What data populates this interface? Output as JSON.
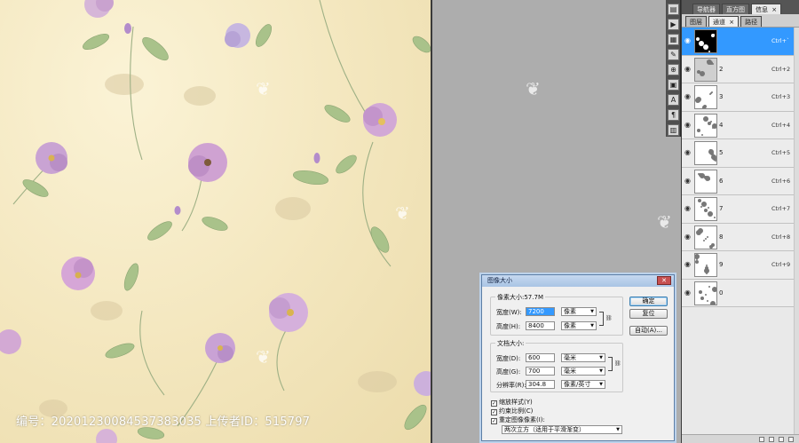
{
  "canvas": {
    "caption": "编号：20201230084537383035 上传者ID：515797"
  },
  "icons": {
    "watermark": "flame-logo-icon",
    "visibility": "eye-icon",
    "close": "close-icon",
    "link": "chain-link-icon",
    "dropdown": "chevron-down-icon"
  },
  "channels_panel": {
    "tabs_top": [
      "导航器",
      "直方图",
      "信息"
    ],
    "tabs_sub": [
      "图层",
      "通道",
      "路径"
    ],
    "channels": [
      {
        "name": "",
        "shortcut": "Ctrl+`",
        "selected": true
      },
      {
        "name": "2",
        "shortcut": "Ctrl+2"
      },
      {
        "name": "3",
        "shortcut": "Ctrl+3"
      },
      {
        "name": "4",
        "shortcut": "Ctrl+4"
      },
      {
        "name": "5",
        "shortcut": "Ctrl+5"
      },
      {
        "name": "6",
        "shortcut": "Ctrl+6"
      },
      {
        "name": "7",
        "shortcut": "Ctrl+7"
      },
      {
        "name": "8",
        "shortcut": "Ctrl+8"
      },
      {
        "name": "9",
        "shortcut": "Ctrl+9"
      },
      {
        "name": "0",
        "shortcut": ""
      }
    ]
  },
  "image_size_dialog": {
    "title": "图像大小",
    "pixel_dimensions_label": "像素大小:57.7M",
    "width_label": "宽度(W):",
    "width_value": "7200",
    "width_unit": "像素",
    "height_label": "高度(H):",
    "height_value": "8400",
    "height_unit": "像素",
    "document_size_label": "文档大小:",
    "doc_width_label": "宽度(D):",
    "doc_width_value": "600",
    "doc_width_unit": "毫米",
    "doc_height_label": "高度(G):",
    "doc_height_value": "700",
    "doc_height_unit": "毫米",
    "resolution_label": "分辨率(R):",
    "resolution_value": "304.8",
    "resolution_unit": "像素/英寸",
    "scale_styles": "缩放样式(Y)",
    "constrain_proportions": "约束比例(C)",
    "resample": "重定图像像素(I):",
    "resample_method": "两次立方（适用于平滑渐变）",
    "ok_button": "确定",
    "reset_button": "复位",
    "auto_button": "自动(A)..."
  }
}
